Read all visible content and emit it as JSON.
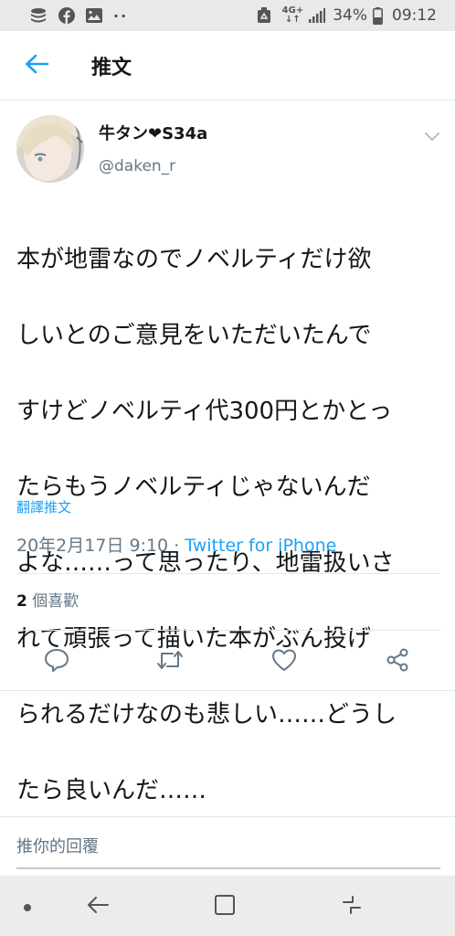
{
  "status_bar": {
    "network_label": "4G+",
    "battery_percent": "34%",
    "time": "09:12",
    "more": "··"
  },
  "header": {
    "title": "推文"
  },
  "tweet": {
    "display_name": "牛タン❤S34a",
    "screen_name": "@daken_r",
    "lines": [
      "本が地雷なのでノベルティだけ欲",
      "しいとのご意見をいただいたんで",
      "すけどノベルティ代300円とかとっ",
      "たらもうノベルティじゃないんだ",
      "よな……って思ったり、地雷扱いさ",
      "れて頑張って描いた本がぶん投げ",
      "られるだけなのも悲しい……どうし",
      "たら良いんだ……"
    ],
    "translate_label": "翻譯推文",
    "date": "20年2月17日 9:10",
    "separator": " · ",
    "source": "Twitter for iPhone",
    "likes_count": "2",
    "likes_label": " 個喜歡"
  },
  "reply": {
    "placeholder": "推你的回覆"
  },
  "colors": {
    "accent": "#1da1f2",
    "icon_gray": "#657786",
    "text": "#14171a"
  }
}
